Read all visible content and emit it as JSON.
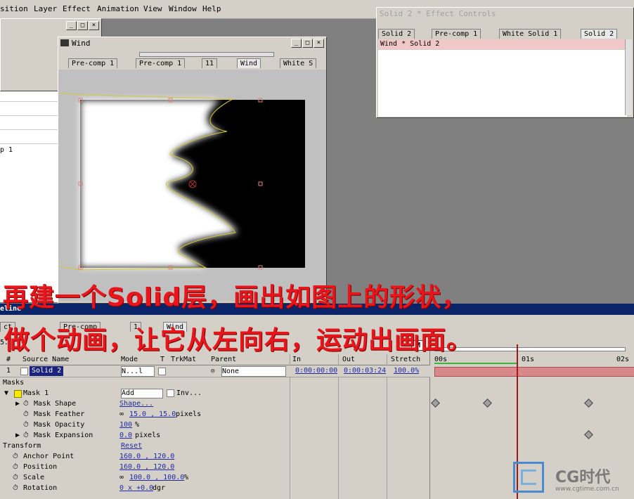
{
  "menubar": {
    "items": [
      "sition",
      "Layer",
      "Effect",
      "Animation",
      "View",
      "Window",
      "Help"
    ]
  },
  "comp_window": {
    "title": "Wind",
    "tabs": [
      "Pre-comp 1",
      "Pre-comp 1",
      "11",
      "Wind",
      "White S"
    ]
  },
  "effect_controls": {
    "title": "Solid 2 * Effect Controls",
    "tabs": [
      "Solid 2",
      "Pre-comp 1",
      "White Solid 1",
      "Solid 2"
    ],
    "header": "Wind * Solid 2"
  },
  "left_panel": {
    "item": "p 1"
  },
  "timeline": {
    "title": "eline",
    "tabs": [
      "ct",
      "Pre-comp",
      "1",
      "Wind"
    ],
    "time_display": "5.",
    "columns": {
      "num": "#",
      "source": "Source Name",
      "mode": "Mode",
      "t": "T",
      "trkmat": "TrkMat",
      "parent": "Parent",
      "in": "In",
      "out": "Out",
      "stretch": "Stretch"
    },
    "ruler": [
      "00s",
      "01s",
      "02s"
    ],
    "layer": {
      "num": "1",
      "name": "Solid 2",
      "mode": "N...l",
      "parent": "None",
      "in": "0:00:00:00",
      "out": "0:00:03:24",
      "stretch": "100.0%"
    },
    "properties": [
      {
        "label": "Masks"
      },
      {
        "label": "Mask 1",
        "value": "Add",
        "extra": "Inv..."
      },
      {
        "label": "Mask Shape",
        "value": "Shape..."
      },
      {
        "label": "Mask Feather",
        "value": "15.0 , 15.0",
        "unit": "pixels"
      },
      {
        "label": "Mask Opacity",
        "value": "100",
        "unit": "%"
      },
      {
        "label": "Mask Expansion",
        "value": "0.0",
        "unit": "pixels"
      },
      {
        "label": "Transform",
        "value": "Reset"
      },
      {
        "label": "Anchor Point",
        "value": "160.0 , 120.0"
      },
      {
        "label": "Position",
        "value": "160.0 , 120.0"
      },
      {
        "label": "Scale",
        "value": "100.0 , 100.0",
        "unit": "%"
      },
      {
        "label": "Rotation",
        "value": "0 x +0.0",
        "unit": "dgr"
      }
    ]
  },
  "captions": {
    "line1": "再建一个Solid层，画出如图上的形状，",
    "line2": "做个动画，让它从左向右，运动出画面。"
  },
  "watermark": {
    "brand": "CG时代",
    "url": "www.cgtime.com.cn"
  },
  "colors": {
    "caption": "#e8151b",
    "timeline_bar": "#d88888",
    "playhead": "#a01818",
    "mask_path": "#d4c832"
  }
}
